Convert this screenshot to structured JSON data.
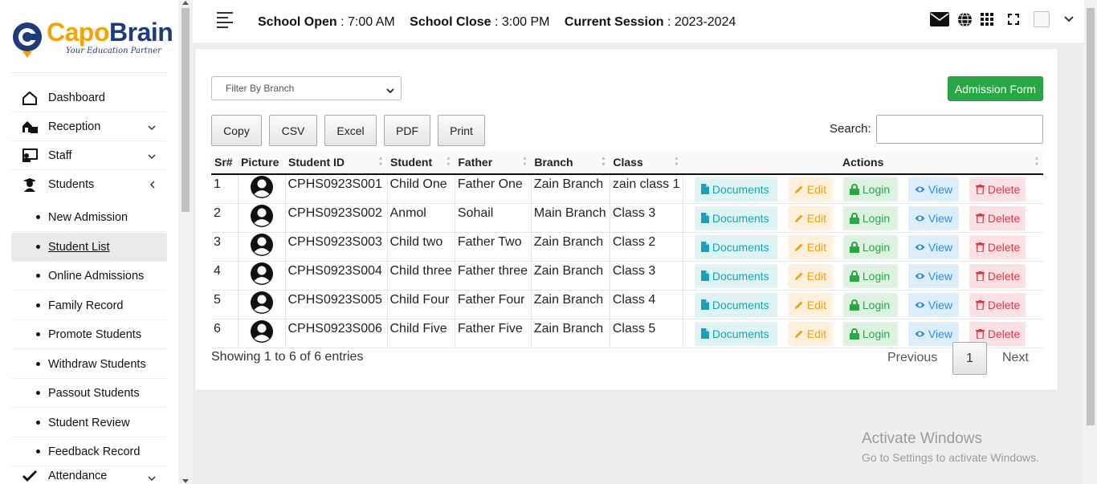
{
  "brand": {
    "name_part1": "Capo",
    "name_part2": "Brain",
    "tagline": "Your Education Partner"
  },
  "sidebar": {
    "items": [
      {
        "label": "Dashboard",
        "icon": "home-icon",
        "chevron": ""
      },
      {
        "label": "Reception",
        "icon": "reception-icon",
        "chevron": "down"
      },
      {
        "label": "Staff",
        "icon": "staff-icon",
        "chevron": "down"
      },
      {
        "label": "Students",
        "icon": "student-icon",
        "chevron": "left"
      }
    ],
    "sub_items": [
      {
        "label": "New Admission",
        "active": false
      },
      {
        "label": "Student List",
        "active": true
      },
      {
        "label": "Online Admissions",
        "active": false
      },
      {
        "label": "Family Record",
        "active": false
      },
      {
        "label": "Promote Students",
        "active": false
      },
      {
        "label": "Withdraw Students",
        "active": false
      },
      {
        "label": "Passout Students",
        "active": false
      },
      {
        "label": "Student Review",
        "active": false
      },
      {
        "label": "Feedback Record",
        "active": false
      }
    ],
    "bottom_item": {
      "label": "Attendance",
      "icon": "check-icon",
      "chevron": "down"
    }
  },
  "header": {
    "open_label": "School Open",
    "open_value": "7:00 AM",
    "close_label": "School Close",
    "close_value": "3:00 PM",
    "session_label": "Current Session",
    "session_value": "2023-2024",
    "icons": [
      "envelope-icon",
      "globe-icon",
      "grid-icon",
      "fullscreen-icon",
      "avatar",
      "chevron-down-icon"
    ]
  },
  "toolbar": {
    "branch_placeholder": "Filter By Branch",
    "admission_button": "Admission Form",
    "export_buttons": [
      "Copy",
      "CSV",
      "Excel",
      "PDF",
      "Print"
    ],
    "search_label": "Search:"
  },
  "table": {
    "columns": [
      "Sr#",
      "Picture",
      "Student ID",
      "Student",
      "Father",
      "Branch",
      "Class",
      "Actions"
    ],
    "rows": [
      {
        "sr": "1",
        "id": "CPHS0923S001",
        "student": "Child One",
        "father": "Father One",
        "branch": "Zain Branch",
        "class": "zain class 1"
      },
      {
        "sr": "2",
        "id": "CPHS0923S002",
        "student": "Anmol",
        "father": "Sohail",
        "branch": "Main Branch",
        "class": "Class 3"
      },
      {
        "sr": "3",
        "id": "CPHS0923S003",
        "student": "Child two",
        "father": "Father Two",
        "branch": "Zain Branch",
        "class": "Class 2"
      },
      {
        "sr": "4",
        "id": "CPHS0923S004",
        "student": "Child three",
        "father": "Father three",
        "branch": "Zain Branch",
        "class": "Class 3"
      },
      {
        "sr": "5",
        "id": "CPHS0923S005",
        "student": "Child Four",
        "father": "Father Four",
        "branch": "Zain Branch",
        "class": "Class 4"
      },
      {
        "sr": "6",
        "id": "CPHS0923S006",
        "student": "Child Five",
        "father": "Father Five",
        "branch": "Zain Branch",
        "class": "Class 5"
      }
    ],
    "actions": [
      "Documents",
      "Edit",
      "Login",
      "View",
      "Delete"
    ]
  },
  "footer": {
    "info": "Showing 1 to 6 of 6 entries",
    "prev": "Previous",
    "page": "1",
    "next": "Next"
  },
  "watermark": {
    "line1": "Activate Windows",
    "line2": "Go to Settings to activate Windows."
  },
  "colors": {
    "brand_orange": "#f5a300",
    "brand_navy": "#1e3c7a",
    "success": "#28a745",
    "info": "#17a2b8",
    "warning": "#f0a018",
    "primary": "#2e8bd6",
    "danger": "#dc3545"
  }
}
